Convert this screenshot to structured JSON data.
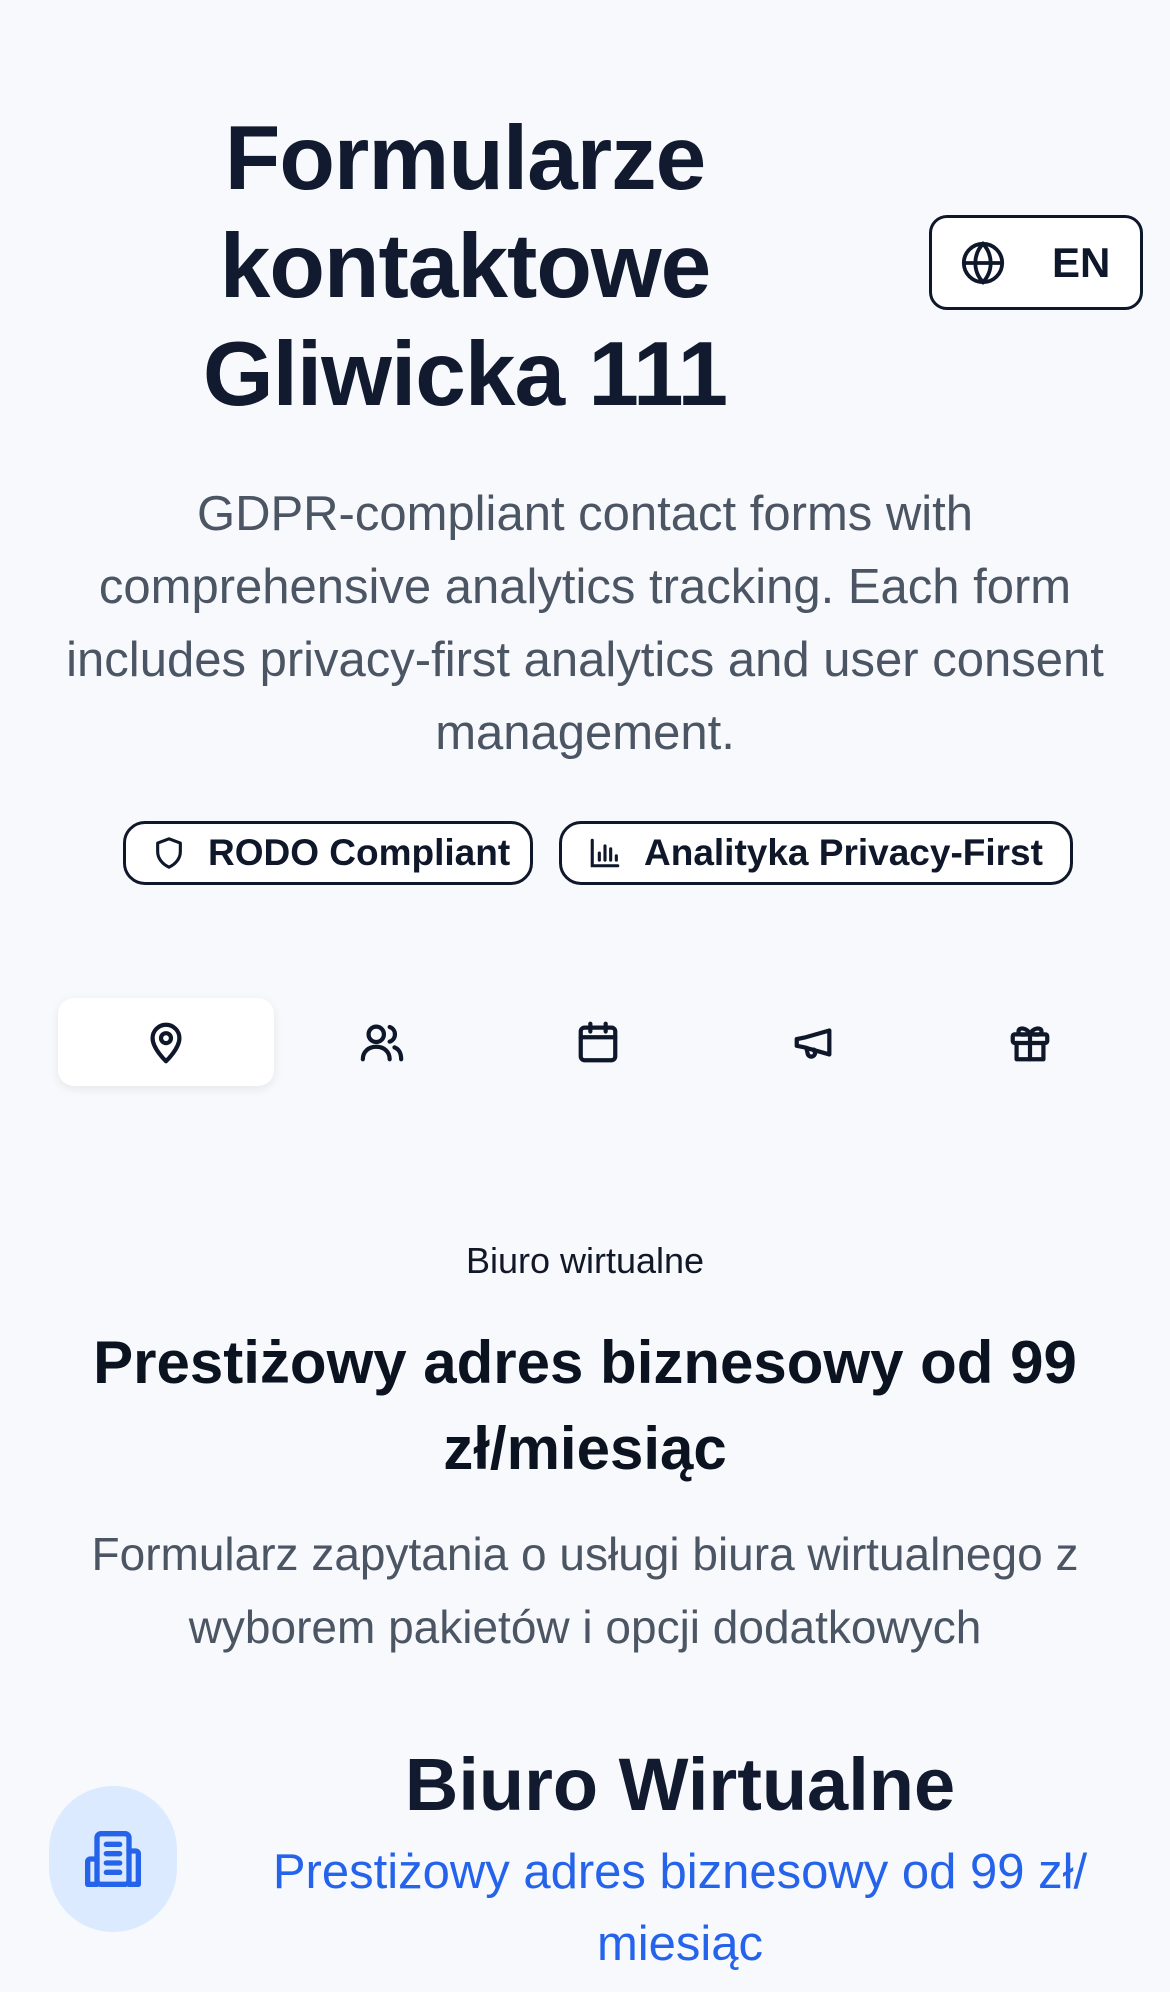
{
  "header": {
    "title": "Formularze kontaktowe Gliwicka 111",
    "language_button": {
      "label": "EN",
      "icon": "globe-icon"
    }
  },
  "intro": {
    "description": "GDPR-compliant contact forms with comprehensive analytics tracking. Each form includes privacy-first analytics and user consent management."
  },
  "badges": [
    {
      "label": "RODO Compliant",
      "icon": "shield-icon"
    },
    {
      "label": "Analityka Privacy-First",
      "icon": "bar-chart-icon"
    }
  ],
  "tabs": [
    {
      "icon": "map-pin-icon",
      "active": true
    },
    {
      "icon": "users-icon",
      "active": false
    },
    {
      "icon": "calendar-icon",
      "active": false
    },
    {
      "icon": "megaphone-icon",
      "active": false
    },
    {
      "icon": "gift-icon",
      "active": false
    }
  ],
  "section": {
    "eyebrow": "Biuro wirtualne",
    "title": "Prestiżowy adres biznesowy od 99 zł/miesiąc",
    "description": "Formularz zapytania o usługi biura wirtualnego z wyborem pakietów i opcji dodatkowych"
  },
  "card": {
    "icon": "building-icon",
    "title": "Biuro Wirtualne",
    "subtitle": "Prestiżowy adres biznesowy od 99 zł/ miesiąc"
  },
  "colors": {
    "background": "#f7f9fc",
    "text": "#0f172a",
    "muted": "#4b5563",
    "accent": "#2563eb",
    "accent_soft": "#dbeafe"
  }
}
